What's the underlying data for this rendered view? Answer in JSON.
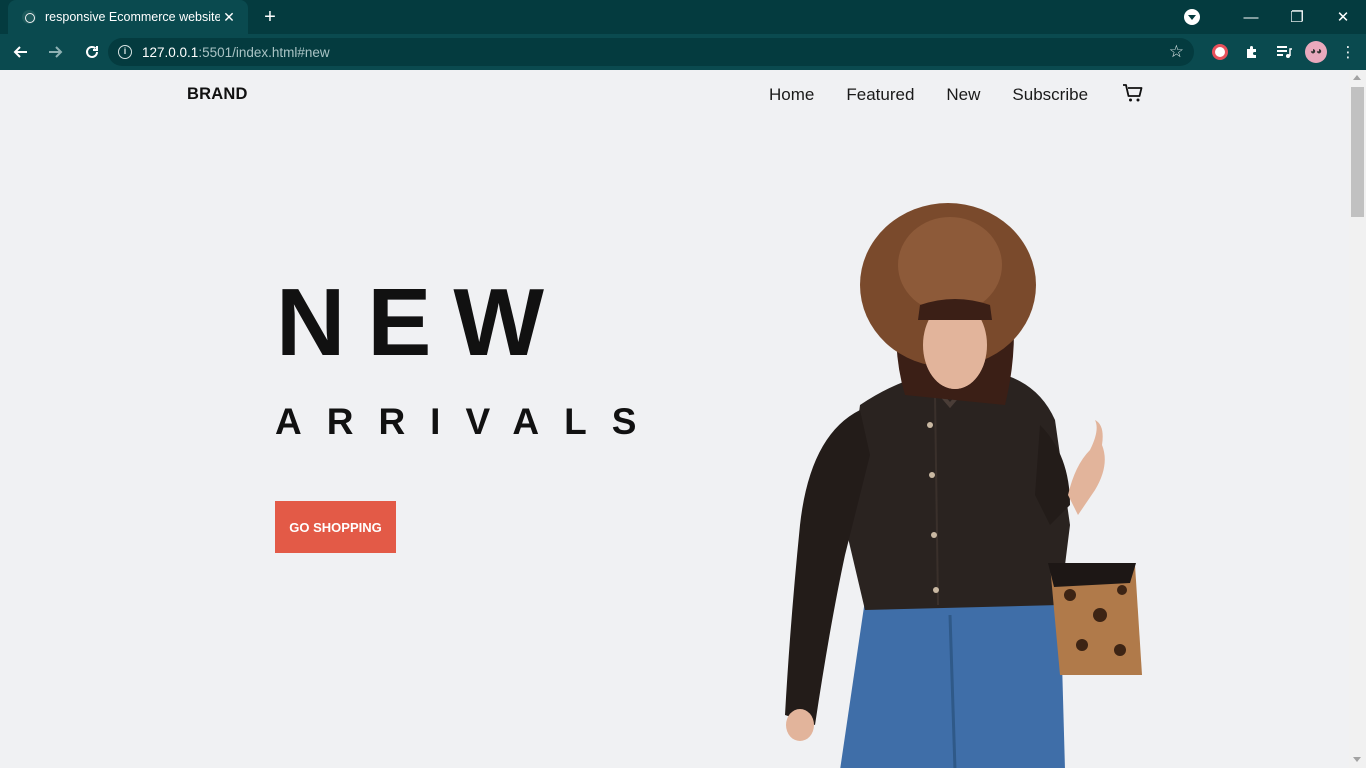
{
  "browser": {
    "tab_title": "responsive Ecommerce website",
    "url_host": "127.0.0.1",
    "url_path": ":5501/index.html#new"
  },
  "site": {
    "brand": "BRAND",
    "nav": [
      {
        "label": "Home"
      },
      {
        "label": "Featured"
      },
      {
        "label": "New"
      },
      {
        "label": "Subscribe"
      }
    ],
    "hero": {
      "title": "NEW",
      "subtitle": "ARRIVALS",
      "cta_label": "GO SHOPPING"
    }
  },
  "colors": {
    "chrome_dark": "#043b3f",
    "chrome_toolbar": "#0a4a4f",
    "page_bg": "#f0f1f3",
    "cta": "#e35a47"
  }
}
